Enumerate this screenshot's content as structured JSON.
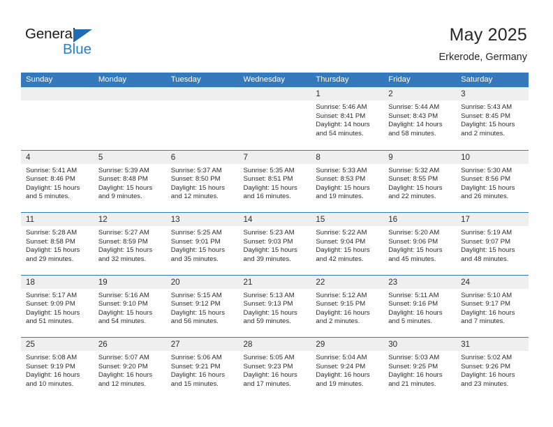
{
  "brand": {
    "word_one": "General",
    "word_two": "Blue",
    "triangle_icon": "triangle-icon",
    "colors": {
      "dark": "#1b1b1b",
      "blue": "#1f80d1",
      "triangle": "#1f6cb4"
    }
  },
  "header": {
    "title": "May 2025",
    "location": "Erkerode, Germany"
  },
  "theme": {
    "header_bar": "#3479bb",
    "day_band": "#efefef",
    "row_divider": "#3479bb",
    "text": "#2b2b2b"
  },
  "weekdays": [
    "Sunday",
    "Monday",
    "Tuesday",
    "Wednesday",
    "Thursday",
    "Friday",
    "Saturday"
  ],
  "weeks": [
    [
      {
        "day": "",
        "empty": true
      },
      {
        "day": "",
        "empty": true
      },
      {
        "day": "",
        "empty": true
      },
      {
        "day": "",
        "empty": true
      },
      {
        "day": "1",
        "sunrise": "Sunrise: 5:46 AM",
        "sunset": "Sunset: 8:41 PM",
        "daylight_1": "Daylight: 14 hours",
        "daylight_2": "and 54 minutes."
      },
      {
        "day": "2",
        "sunrise": "Sunrise: 5:44 AM",
        "sunset": "Sunset: 8:43 PM",
        "daylight_1": "Daylight: 14 hours",
        "daylight_2": "and 58 minutes."
      },
      {
        "day": "3",
        "sunrise": "Sunrise: 5:43 AM",
        "sunset": "Sunset: 8:45 PM",
        "daylight_1": "Daylight: 15 hours",
        "daylight_2": "and 2 minutes."
      }
    ],
    [
      {
        "day": "4",
        "sunrise": "Sunrise: 5:41 AM",
        "sunset": "Sunset: 8:46 PM",
        "daylight_1": "Daylight: 15 hours",
        "daylight_2": "and 5 minutes."
      },
      {
        "day": "5",
        "sunrise": "Sunrise: 5:39 AM",
        "sunset": "Sunset: 8:48 PM",
        "daylight_1": "Daylight: 15 hours",
        "daylight_2": "and 9 minutes."
      },
      {
        "day": "6",
        "sunrise": "Sunrise: 5:37 AM",
        "sunset": "Sunset: 8:50 PM",
        "daylight_1": "Daylight: 15 hours",
        "daylight_2": "and 12 minutes."
      },
      {
        "day": "7",
        "sunrise": "Sunrise: 5:35 AM",
        "sunset": "Sunset: 8:51 PM",
        "daylight_1": "Daylight: 15 hours",
        "daylight_2": "and 16 minutes."
      },
      {
        "day": "8",
        "sunrise": "Sunrise: 5:33 AM",
        "sunset": "Sunset: 8:53 PM",
        "daylight_1": "Daylight: 15 hours",
        "daylight_2": "and 19 minutes."
      },
      {
        "day": "9",
        "sunrise": "Sunrise: 5:32 AM",
        "sunset": "Sunset: 8:55 PM",
        "daylight_1": "Daylight: 15 hours",
        "daylight_2": "and 22 minutes."
      },
      {
        "day": "10",
        "sunrise": "Sunrise: 5:30 AM",
        "sunset": "Sunset: 8:56 PM",
        "daylight_1": "Daylight: 15 hours",
        "daylight_2": "and 26 minutes."
      }
    ],
    [
      {
        "day": "11",
        "sunrise": "Sunrise: 5:28 AM",
        "sunset": "Sunset: 8:58 PM",
        "daylight_1": "Daylight: 15 hours",
        "daylight_2": "and 29 minutes."
      },
      {
        "day": "12",
        "sunrise": "Sunrise: 5:27 AM",
        "sunset": "Sunset: 8:59 PM",
        "daylight_1": "Daylight: 15 hours",
        "daylight_2": "and 32 minutes."
      },
      {
        "day": "13",
        "sunrise": "Sunrise: 5:25 AM",
        "sunset": "Sunset: 9:01 PM",
        "daylight_1": "Daylight: 15 hours",
        "daylight_2": "and 35 minutes."
      },
      {
        "day": "14",
        "sunrise": "Sunrise: 5:23 AM",
        "sunset": "Sunset: 9:03 PM",
        "daylight_1": "Daylight: 15 hours",
        "daylight_2": "and 39 minutes."
      },
      {
        "day": "15",
        "sunrise": "Sunrise: 5:22 AM",
        "sunset": "Sunset: 9:04 PM",
        "daylight_1": "Daylight: 15 hours",
        "daylight_2": "and 42 minutes."
      },
      {
        "day": "16",
        "sunrise": "Sunrise: 5:20 AM",
        "sunset": "Sunset: 9:06 PM",
        "daylight_1": "Daylight: 15 hours",
        "daylight_2": "and 45 minutes."
      },
      {
        "day": "17",
        "sunrise": "Sunrise: 5:19 AM",
        "sunset": "Sunset: 9:07 PM",
        "daylight_1": "Daylight: 15 hours",
        "daylight_2": "and 48 minutes."
      }
    ],
    [
      {
        "day": "18",
        "sunrise": "Sunrise: 5:17 AM",
        "sunset": "Sunset: 9:09 PM",
        "daylight_1": "Daylight: 15 hours",
        "daylight_2": "and 51 minutes."
      },
      {
        "day": "19",
        "sunrise": "Sunrise: 5:16 AM",
        "sunset": "Sunset: 9:10 PM",
        "daylight_1": "Daylight: 15 hours",
        "daylight_2": "and 54 minutes."
      },
      {
        "day": "20",
        "sunrise": "Sunrise: 5:15 AM",
        "sunset": "Sunset: 9:12 PM",
        "daylight_1": "Daylight: 15 hours",
        "daylight_2": "and 56 minutes."
      },
      {
        "day": "21",
        "sunrise": "Sunrise: 5:13 AM",
        "sunset": "Sunset: 9:13 PM",
        "daylight_1": "Daylight: 15 hours",
        "daylight_2": "and 59 minutes."
      },
      {
        "day": "22",
        "sunrise": "Sunrise: 5:12 AM",
        "sunset": "Sunset: 9:15 PM",
        "daylight_1": "Daylight: 16 hours",
        "daylight_2": "and 2 minutes."
      },
      {
        "day": "23",
        "sunrise": "Sunrise: 5:11 AM",
        "sunset": "Sunset: 9:16 PM",
        "daylight_1": "Daylight: 16 hours",
        "daylight_2": "and 5 minutes."
      },
      {
        "day": "24",
        "sunrise": "Sunrise: 5:10 AM",
        "sunset": "Sunset: 9:17 PM",
        "daylight_1": "Daylight: 16 hours",
        "daylight_2": "and 7 minutes."
      }
    ],
    [
      {
        "day": "25",
        "sunrise": "Sunrise: 5:08 AM",
        "sunset": "Sunset: 9:19 PM",
        "daylight_1": "Daylight: 16 hours",
        "daylight_2": "and 10 minutes."
      },
      {
        "day": "26",
        "sunrise": "Sunrise: 5:07 AM",
        "sunset": "Sunset: 9:20 PM",
        "daylight_1": "Daylight: 16 hours",
        "daylight_2": "and 12 minutes."
      },
      {
        "day": "27",
        "sunrise": "Sunrise: 5:06 AM",
        "sunset": "Sunset: 9:21 PM",
        "daylight_1": "Daylight: 16 hours",
        "daylight_2": "and 15 minutes."
      },
      {
        "day": "28",
        "sunrise": "Sunrise: 5:05 AM",
        "sunset": "Sunset: 9:23 PM",
        "daylight_1": "Daylight: 16 hours",
        "daylight_2": "and 17 minutes."
      },
      {
        "day": "29",
        "sunrise": "Sunrise: 5:04 AM",
        "sunset": "Sunset: 9:24 PM",
        "daylight_1": "Daylight: 16 hours",
        "daylight_2": "and 19 minutes."
      },
      {
        "day": "30",
        "sunrise": "Sunrise: 5:03 AM",
        "sunset": "Sunset: 9:25 PM",
        "daylight_1": "Daylight: 16 hours",
        "daylight_2": "and 21 minutes."
      },
      {
        "day": "31",
        "sunrise": "Sunrise: 5:02 AM",
        "sunset": "Sunset: 9:26 PM",
        "daylight_1": "Daylight: 16 hours",
        "daylight_2": "and 23 minutes."
      }
    ]
  ]
}
